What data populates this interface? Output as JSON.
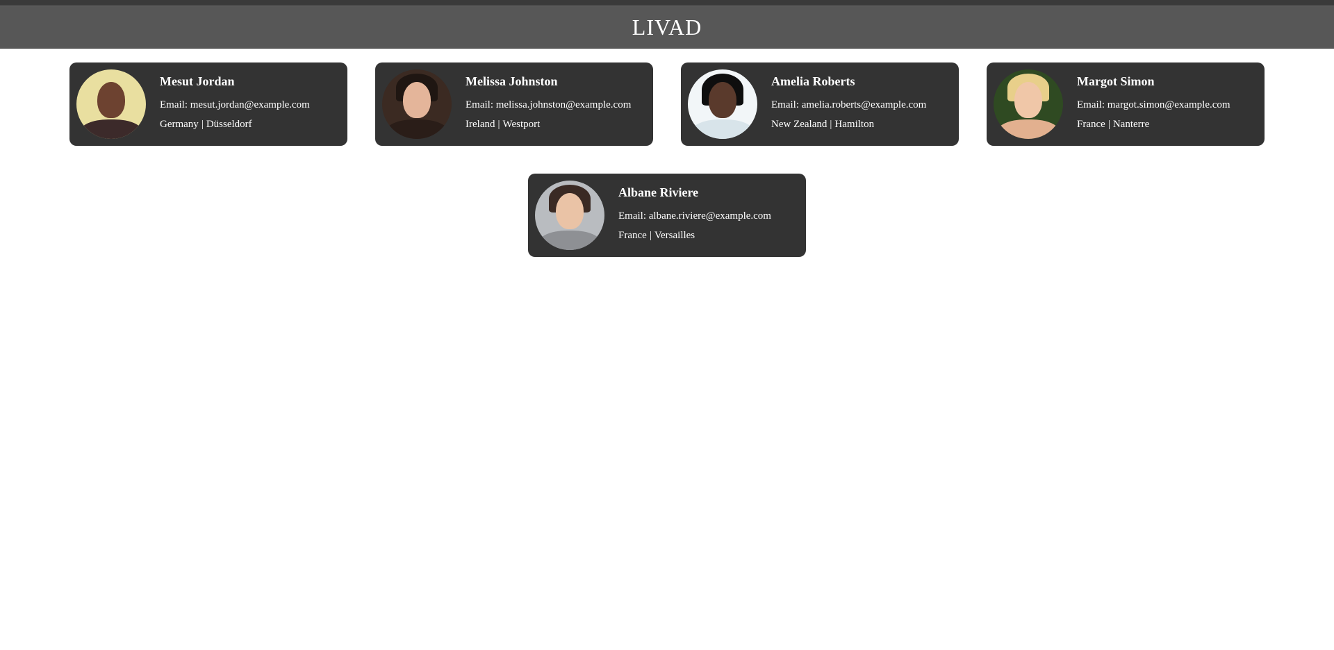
{
  "header": {
    "title": "LIVAD"
  },
  "users": [
    {
      "name": "Mesut Jordan",
      "email_label": "Email:",
      "email": "mesut.jordan@example.com",
      "country": "Germany",
      "city": "Düsseldorf",
      "separator": "|"
    },
    {
      "name": "Melissa Johnston",
      "email_label": "Email:",
      "email": "melissa.johnston@example.com",
      "country": "Ireland",
      "city": "Westport",
      "separator": "|"
    },
    {
      "name": "Amelia Roberts",
      "email_label": "Email:",
      "email": "amelia.roberts@example.com",
      "country": "New Zealand",
      "city": "Hamilton",
      "separator": "|"
    },
    {
      "name": "Margot Simon",
      "email_label": "Email:",
      "email": "margot.simon@example.com",
      "country": "France",
      "city": "Nanterre",
      "separator": "|"
    },
    {
      "name": "Albane Riviere",
      "email_label": "Email:",
      "email": "albane.riviere@example.com",
      "country": "France",
      "city": "Versailles",
      "separator": "|"
    }
  ],
  "colors": {
    "header_bg": "#575757",
    "card_bg": "#333333",
    "text": "#ffffff"
  }
}
